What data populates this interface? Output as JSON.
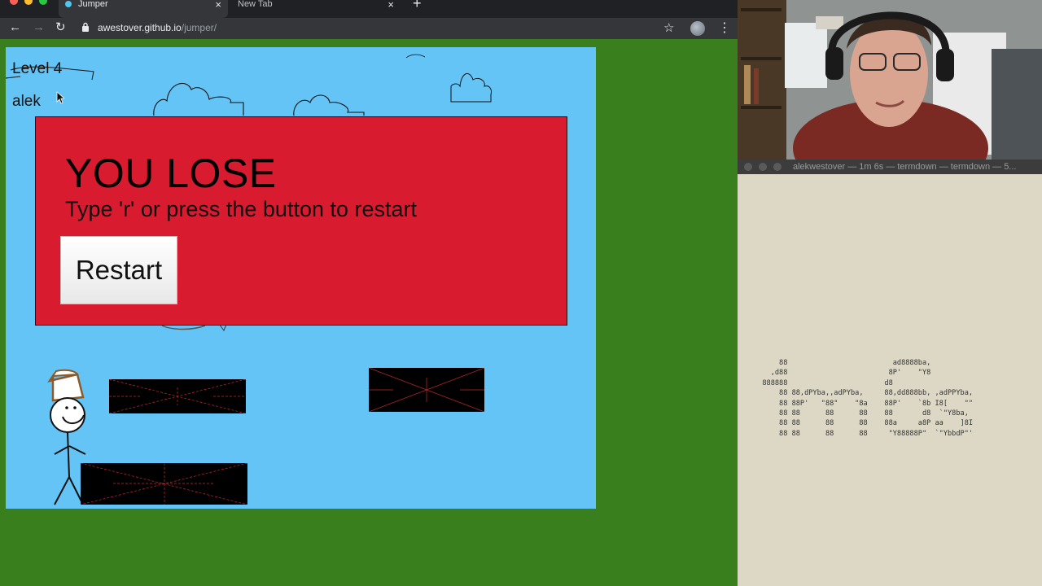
{
  "browser": {
    "tabs": [
      {
        "title": "Jumper",
        "active": true
      },
      {
        "title": "New Tab",
        "active": false
      }
    ],
    "new_tab_symbol": "+",
    "url_host": "awestover.github.io",
    "url_path": "/jumper/",
    "icons": [
      "back-arrow-icon",
      "forward-arrow-icon",
      "reload-icon",
      "lock-icon",
      "star-icon",
      "extension-icon",
      "kebab-menu-icon"
    ],
    "glyphs": {
      "back": "←",
      "forward": "→",
      "reload": "↻",
      "lock": "🔒",
      "star": "☆",
      "menu": "⋮",
      "close": "×"
    }
  },
  "game": {
    "level_label": "Level 4",
    "player_name": "alek",
    "lose_title": "YOU LOSE",
    "lose_subtitle": "Type 'r' or press the button to restart",
    "restart_label": "Restart",
    "colors": {
      "sky": "#64c4f5",
      "panel": "#d81b2e",
      "grass": "#3a7f1e",
      "platform": "#000000"
    }
  },
  "terminal": {
    "title": "alekwestover — 1m 6s — termdown — termdown — 5...",
    "ascii_art": "      88                         ad8888ba,\n    ,d88                        8P'    \"Y8\n  888888                       d8\n      88 88,dPYba,,adPYba,     88,dd888bb, ,adPPYba,\n      88 88P'   \"88\"    \"8a    88P'    `8b I8[    \"\"\n      88 88      88      88    88       d8  `\"Y8ba,\n      88 88      88      88    88a     a8P aa    ]8I\n      88 88      88      88     \"Y88888P\"  `\"YbbdP\"'"
  },
  "webcam": {
    "description_icon": "webcam-feed"
  }
}
